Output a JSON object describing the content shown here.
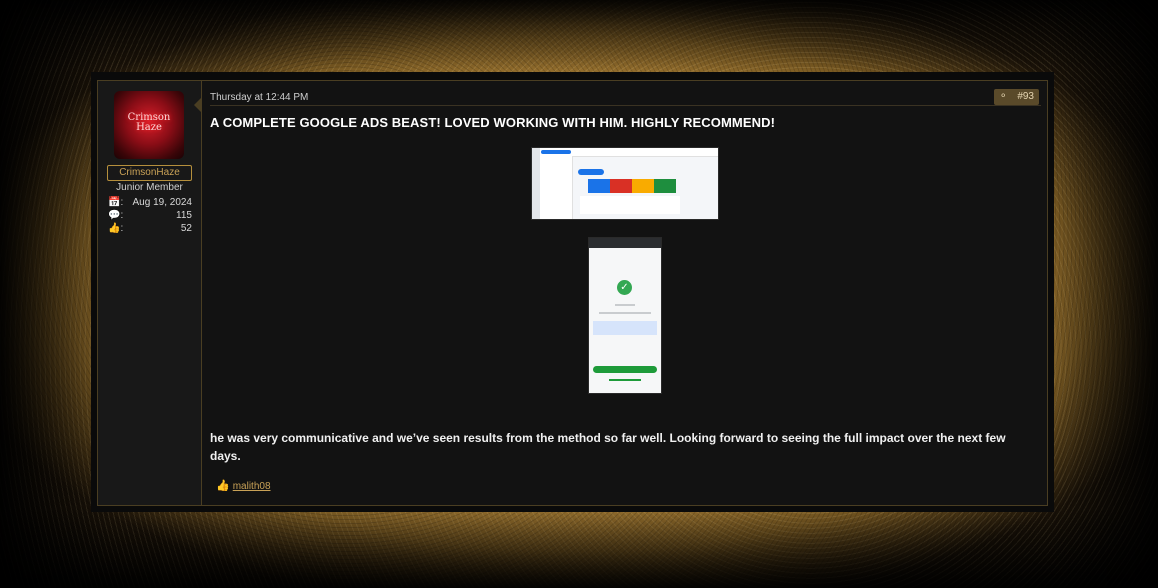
{
  "user": {
    "avatar_text": "Crimson Haze",
    "username": "CrimsonHaze",
    "title": "Junior Member",
    "stats": [
      {
        "icon": "calendar-icon",
        "label": ":",
        "value": "Aug 19, 2024"
      },
      {
        "icon": "messages-icon",
        "label": ":",
        "value": "115"
      },
      {
        "icon": "thumbs-up-icon",
        "label": ":",
        "value": "52"
      }
    ]
  },
  "post": {
    "date": "Thursday at 12:44 PM",
    "number": "#93",
    "headline": "A COMPLETE GOOGLE ADS BEAST! LOVED WORKING WITH HIM. HIGHLY RECOMMEND!",
    "body": "he was very communicative and we’ve seen results from the method so far well. Looking forward to seeing the full impact over the next few days.",
    "reaction_user": "malith08"
  },
  "colors": {
    "accent_gold": "#c9a257",
    "border": "#4a3e22",
    "badge_bg": "#5a4a2a",
    "card_blue": "#1a73e8",
    "card_red": "#d93025",
    "card_yellow": "#f9ab00",
    "card_green": "#1e8e3e"
  }
}
